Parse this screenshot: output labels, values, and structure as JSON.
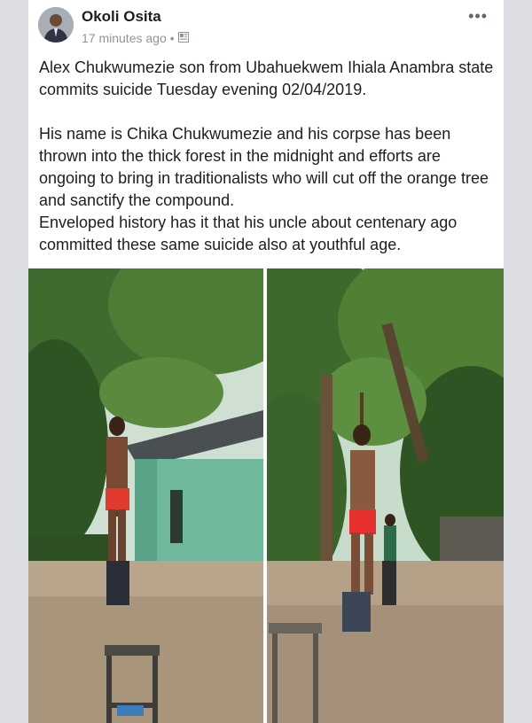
{
  "post": {
    "author": "Okoli Osita",
    "timestamp": "17 minutes ago",
    "separator": "•",
    "privacy_icon": "friends-icon",
    "more_label": "•••",
    "paragraphs": [
      "Alex Chukwumezie son from Ubahuekwem Ihiala Anambra state commits suicide Tuesday evening 02/04/2019.",
      "His name is Chika Chukwumezie and his corpse has been thrown into the thick forest in the midnight and efforts are ongoing to bring in traditionalists who will cut off the orange tree and sanctify the compound.",
      "Enveloped history has it that his uncle about centenary ago committed these same suicide also at youthful age."
    ]
  },
  "colors": {
    "background": "#dcdee3",
    "card": "#ffffff",
    "text": "#1c1e21",
    "meta": "#90949c"
  }
}
